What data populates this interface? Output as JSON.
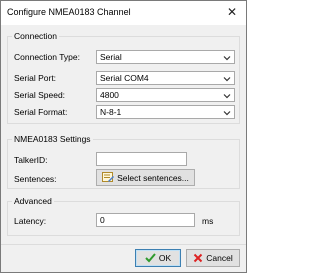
{
  "window": {
    "title": "Configure NMEA0183 Channel"
  },
  "connection": {
    "legend": "Connection",
    "type_label": "Connection Type:",
    "type_value": "Serial",
    "port_label": "Serial Port:",
    "port_value": "Serial COM4",
    "speed_label": "Serial Speed:",
    "speed_value": "4800",
    "format_label": "Serial Format:",
    "format_value": "N-8-1"
  },
  "nmea": {
    "legend": "NMEA0183 Settings",
    "talker_label": "TalkerID:",
    "talker_value": "",
    "sentences_label": "Sentences:",
    "sentences_button": "Select sentences..."
  },
  "advanced": {
    "legend": "Advanced",
    "latency_label": "Latency:",
    "latency_value": "0",
    "latency_unit": "ms"
  },
  "footer": {
    "ok_label": "OK",
    "cancel_label": "Cancel"
  },
  "colors": {
    "ok_check": "#2e9a2e",
    "cancel_x": "#d22"
  }
}
